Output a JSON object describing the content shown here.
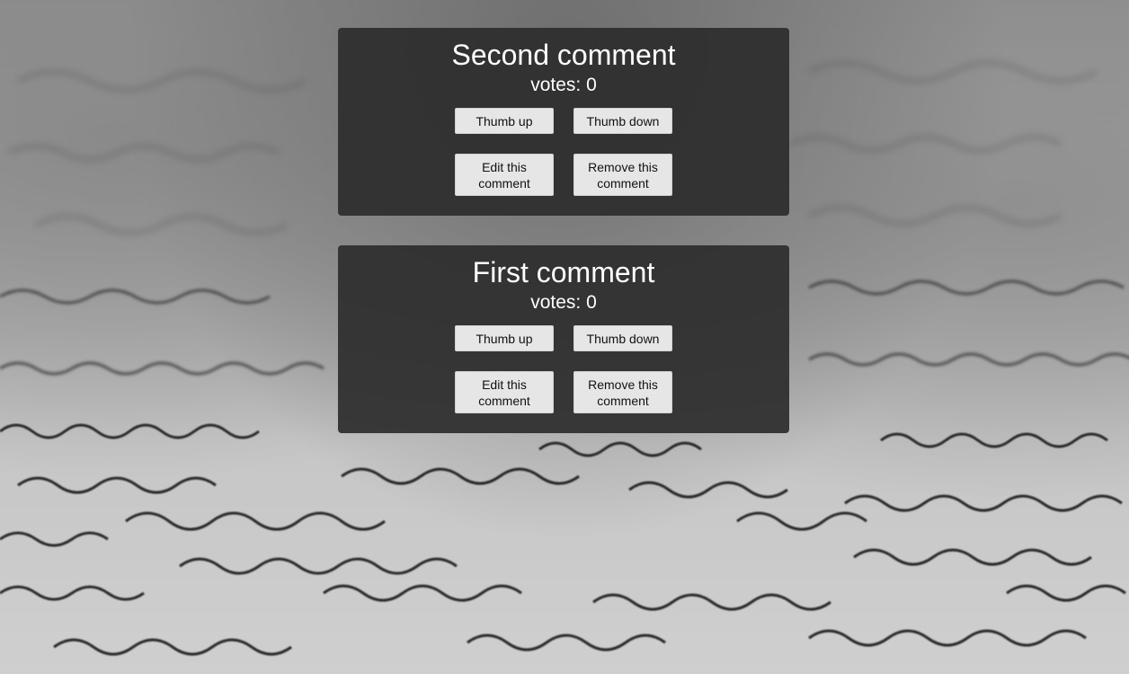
{
  "comments": [
    {
      "title": "Second comment",
      "votes": "votes: 0",
      "thumb_up": "Thumb up",
      "thumb_down": "Thumb down",
      "edit": "Edit this comment",
      "remove": "Remove this comment"
    },
    {
      "title": "First comment",
      "votes": "votes: 0",
      "thumb_up": "Thumb up",
      "thumb_down": "Thumb down",
      "edit": "Edit this comment",
      "remove": "Remove this comment"
    }
  ],
  "colors": {
    "card_background": "#2c2c2c",
    "button_background": "#e6e6e6",
    "text_light": "#ffffff",
    "text_dark": "#111111"
  }
}
